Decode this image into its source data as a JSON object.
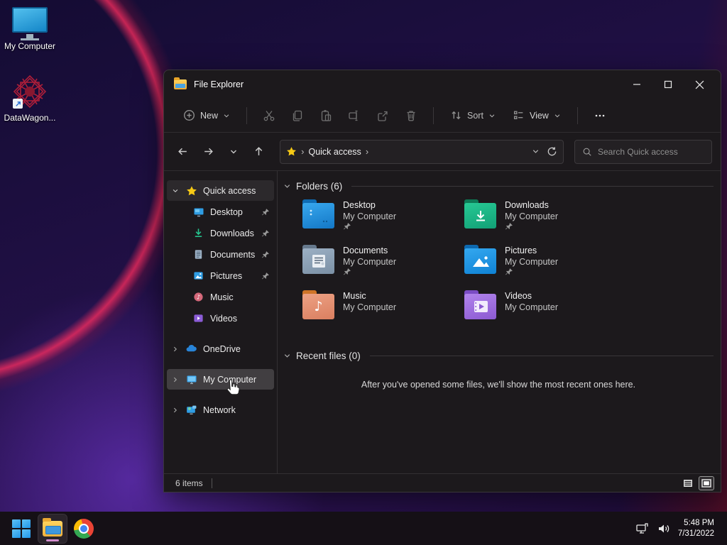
{
  "desktop": {
    "icons": [
      {
        "label": "My Computer"
      },
      {
        "label": "DataWagon..."
      }
    ]
  },
  "window": {
    "title": "File Explorer",
    "toolbar": {
      "new_label": "New",
      "sort_label": "Sort",
      "view_label": "View"
    },
    "address": {
      "breadcrumb_root": "Quick access",
      "crumb_sep": "›",
      "search_placeholder": "Search Quick access"
    },
    "sidebar": {
      "items": [
        {
          "label": "Quick access"
        },
        {
          "label": "Desktop"
        },
        {
          "label": "Downloads"
        },
        {
          "label": "Documents"
        },
        {
          "label": "Pictures"
        },
        {
          "label": "Music"
        },
        {
          "label": "Videos"
        },
        {
          "label": "OneDrive"
        },
        {
          "label": "My Computer"
        },
        {
          "label": "Network"
        }
      ]
    },
    "content": {
      "folders_header": "Folders (6)",
      "tiles": [
        {
          "name": "Desktop",
          "location": "My Computer",
          "pinned": true
        },
        {
          "name": "Downloads",
          "location": "My Computer",
          "pinned": true
        },
        {
          "name": "Documents",
          "location": "My Computer",
          "pinned": true
        },
        {
          "name": "Pictures",
          "location": "My Computer",
          "pinned": true
        },
        {
          "name": "Music",
          "location": "My Computer",
          "pinned": false
        },
        {
          "name": "Videos",
          "location": "My Computer",
          "pinned": false
        }
      ],
      "recent_header": "Recent files (0)",
      "recent_empty_message": "After you've opened some files, we'll show the most recent ones here."
    },
    "statusbar": {
      "count": "6 items"
    }
  },
  "taskbar": {
    "clock": {
      "time": "5:48 PM",
      "date": "7/31/2022"
    }
  },
  "icons": {
    "new": "plus-circle",
    "cut": "scissors",
    "copy": "two-pages",
    "paste": "clipboard",
    "rename": "rename-box",
    "share": "share-arrow",
    "delete": "trash",
    "sort": "up-down-arrows",
    "view": "list-layout",
    "more": "three-dots",
    "search": "magnifier",
    "refresh": "circular-arrow",
    "quick_access": "gold-star",
    "pin": "pushpin",
    "music_note": "♪"
  },
  "colors": {
    "folder_blue": "#2a9fe8",
    "downloads_green": "#1cbf8c",
    "documents_gray": "#8ea4b8",
    "pictures_blue": "#22a0ea",
    "music_salmon": "#e49274",
    "videos_purple": "#9d6cdd",
    "star_gold": "#f6c915",
    "selection_gray": "#413e41",
    "taskbar_underline": "#d28ccd",
    "wallpaper_purple": "#251048",
    "wallpaper_red_arc": "#ff2d5f"
  }
}
